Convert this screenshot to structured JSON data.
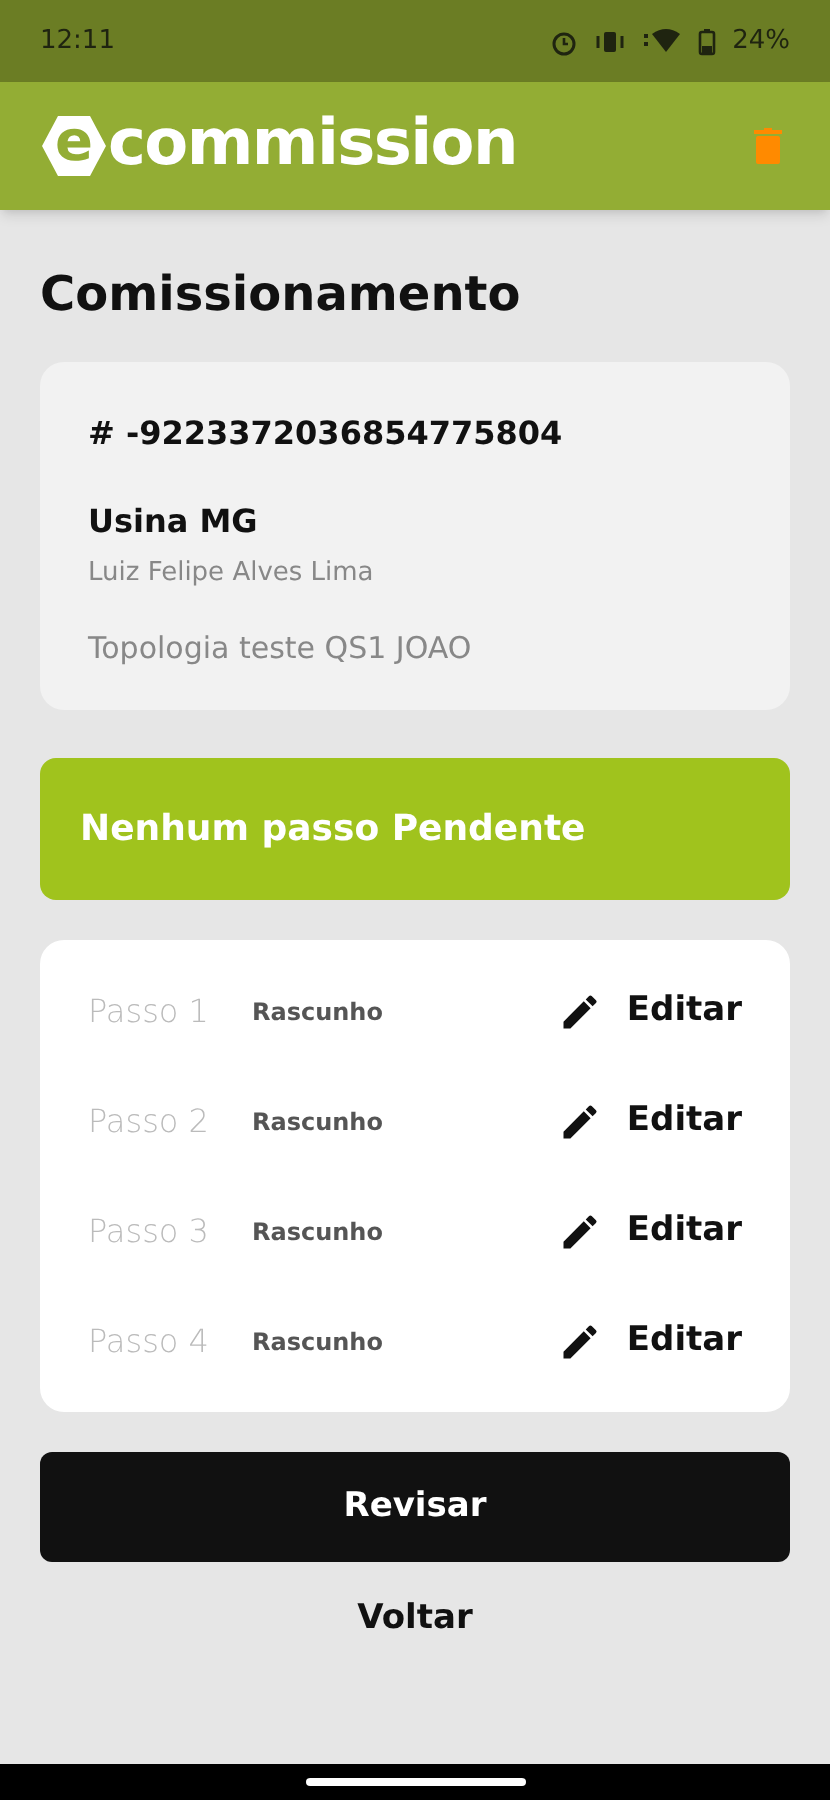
{
  "status_bar": {
    "time": "12:11",
    "battery": "24%"
  },
  "app_bar": {
    "logo_mark": "e",
    "logo_text": "commission"
  },
  "title": "Comissionamento",
  "info_card": {
    "id": "# -9223372036854775804",
    "plant": "Usina MG",
    "person": "Luiz Felipe Alves Lima",
    "topology": "Topologia teste QS1 JOAO"
  },
  "banner": "Nenhum passo Pendente",
  "steps": [
    {
      "label": "Passo 1",
      "status": "Rascunho",
      "action": "Editar"
    },
    {
      "label": "Passo 2",
      "status": "Rascunho",
      "action": "Editar"
    },
    {
      "label": "Passo 3",
      "status": "Rascunho",
      "action": "Editar"
    },
    {
      "label": "Passo 4",
      "status": "Rascunho",
      "action": "Editar"
    }
  ],
  "buttons": {
    "primary": "Revisar",
    "secondary": "Voltar"
  }
}
